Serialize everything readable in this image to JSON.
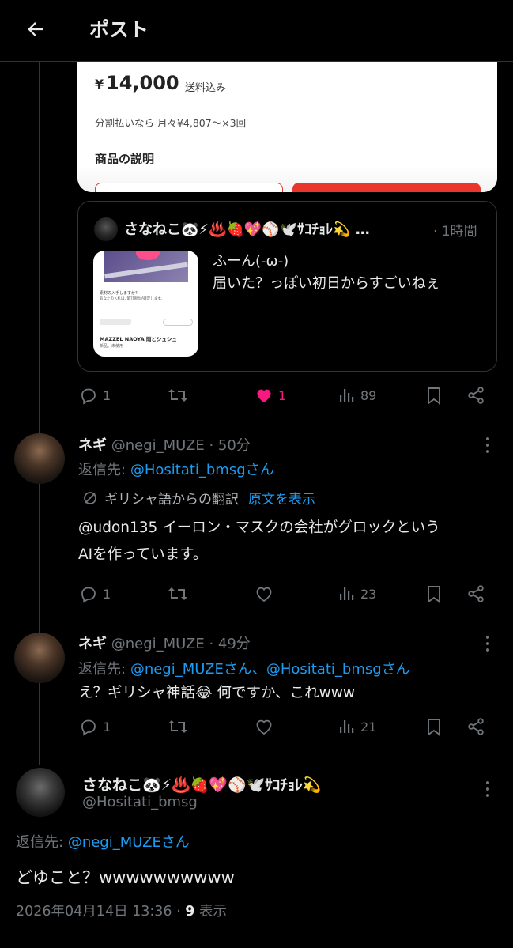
{
  "header": {
    "title": "ポスト"
  },
  "product": {
    "price_currency": "¥",
    "price": "14,000",
    "shipping": "送料込み",
    "installments": "分割払いなら 月々¥4,807〜×3回",
    "description_heading": "商品の説明"
  },
  "quote": {
    "author": "さなねこ🐼⚡♨️🍓💖⚾🕊️ｻｺﾁｮﾚ💫 …",
    "time": "· 1時間",
    "lines": [
      "ふーん(-ω-)",
      "届いた？っぽい初日からすごいねぇ"
    ],
    "thumb": {
      "line1": "素材の入手しますか?",
      "line2": "あなたの入札は, 第7期間が確定します。",
      "title": "MAZZEL NAOYA 雨とシュシュ",
      "condition": "新品、未使用"
    }
  },
  "quote_actions": {
    "replies": "1",
    "likes": "1",
    "views": "89"
  },
  "reply1": {
    "name": "ネギ",
    "handle_time": "@negi_MUZE · 50分",
    "replying_label": "返信先:",
    "replying_to": "@Hositati_bmsgさん",
    "translated_from": "ギリシャ語からの翻訳",
    "show_original": "原文を表示",
    "text_line1": "@udon135 イーロン・マスクの会社がグロックという",
    "text_line2": "AIを作っています。",
    "replies": "1",
    "views": "23"
  },
  "reply2": {
    "name": "ネギ",
    "handle_time": "@negi_MUZE · 49分",
    "replying_label": "返信先:",
    "replying_to": "@negi_MUZEさん、@Hositati_bmsgさん",
    "text": "え？ギリシャ神話😂 何ですか、これwww",
    "replies": "1",
    "views": "21"
  },
  "main_post": {
    "name": "さなねこ🐼⚡♨️🍓💖⚾🕊️ｻｺﾁｮﾚ💫",
    "handle": "@Hositati_bmsg",
    "replying_label": "返信先:",
    "replying_to": "@negi_MUZEさん",
    "text": "どゆこと？wwwwwwwwww",
    "datetime": "2026年04月14日 13:36 · ",
    "views_count": "9",
    "views_label": " 表示"
  },
  "colors": {
    "accent": "#1d9bf0",
    "like": "#f91880",
    "muted": "#71767b",
    "background": "#000000"
  },
  "icons": [
    "back-arrow-icon",
    "reply-icon",
    "retweet-icon",
    "heart-icon",
    "views-icon",
    "bookmark-icon",
    "share-icon",
    "more-icon",
    "translate-icon"
  ]
}
